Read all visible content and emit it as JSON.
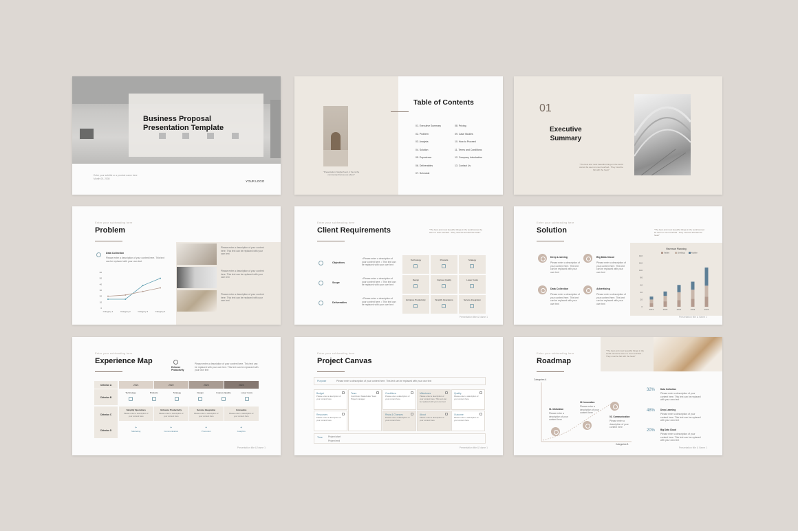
{
  "slide1": {
    "title_line1": "Business Proposal",
    "title_line2": "Presentation Template",
    "subtitle": "Enter your subtitle or a product name here",
    "date": "Month 00, 2030",
    "logo": "YOUR LOGO"
  },
  "slide2": {
    "title": "Table of Contents",
    "caption": "\"Presentation Neigborhood, tr the is the community that we are about\"",
    "items_left": [
      "01. Executive Summary",
      "02. Problem",
      "03. Analysis",
      "04. Solution",
      "05. Experience",
      "06. Deliverables",
      "07. Schedule"
    ],
    "items_right": [
      "08. Pricing",
      "09. Case Studies",
      "10. How to Proceed",
      "11. Terms and Conditions",
      "12. Company Introduction",
      "13. Contact Us"
    ]
  },
  "slide3": {
    "number": "01",
    "title_line1": "Executive",
    "title_line2": "Summary",
    "quote": "\"The best and most beautiful things in the world cannot be seen or even touched - They must be felt with the heart\""
  },
  "slide4": {
    "eyebrow": "Enter your subheading here",
    "title": "Problem",
    "section_title": "Data Collection",
    "section_text": "Please enter a description of your content here. This text can be replaced with your own text",
    "photo_texts": [
      "Please enter a description of your content here. This text can be replaced with your own text",
      "Please enter a description of your content here. This text can be replaced with your own text",
      "Please enter a description of your content here. This text can be replaced with your own text"
    ]
  },
  "slide5": {
    "eyebrow": "Enter your subheading here",
    "title": "Client Requirements",
    "quote": "\"The best and most beautiful things in the world cannot be seen or even touched - They must be felt with the heart\"",
    "rows": [
      {
        "label": "Objectives",
        "text": "• Please enter a description of your content here. • This text can be replaced with your own text"
      },
      {
        "label": "Scope",
        "text": "• Please enter a description of your content here. • This text can be replaced with your own text"
      },
      {
        "label": "Deliverables",
        "text": "• Please enter a description of your content here. • This text can be replaced with your own text"
      }
    ],
    "grid": [
      "Technology",
      "Products",
      "Strategy",
      "Design",
      "Improve Quality",
      "Lower Costs",
      "Enhance Productivity",
      "Simplify Operations",
      "Service Integration"
    ],
    "footer": "Presentation title & Name  1"
  },
  "slide6": {
    "eyebrow": "Enter your subheading here",
    "title": "Solution",
    "quote": "\"The best and most beautiful things in the world cannot be seen or even touched - They must be felt with the heart\"",
    "items": [
      {
        "title": "Deep Learning",
        "text": "Please enter a description of your content here. This text can be replaced with your own text"
      },
      {
        "title": "Big Data Cloud",
        "text": "Please enter a description of your content here. This text can be replaced with your own text"
      },
      {
        "title": "Data Collection",
        "text": "Please enter a description of your content here. This text can be replaced with your own text"
      },
      {
        "title": "Advertising",
        "text": "Please enter a description of your content here. This text can be replaced with your own text"
      }
    ],
    "footer": "Presentation title & Name  1"
  },
  "slide7": {
    "eyebrow": "Enter your subheading here",
    "title": "Experience Map",
    "badge": "Enhance Productivity",
    "desc": "Please enter a description of your content here. This text can be replaced with your own text. This text can be replaced with your own text",
    "years": [
      "2021",
      "2022",
      "2023",
      "2024"
    ],
    "criteria": [
      "Criterion A",
      "Criterion B",
      "Criterion C",
      "Criterion D"
    ],
    "rowB": [
      "Technology",
      "Products",
      "Strategy",
      "Design",
      "Improve Quality",
      "Lower Costs"
    ],
    "rowC": [
      "Simplify Operations",
      "Enhance Productivity",
      "Service Integration",
      "Innovation"
    ],
    "rowD": [
      "Marketing",
      "Communication",
      "Promotion",
      "Analytics"
    ],
    "cell_text": "Please enter a description of your content here",
    "footer": "Presentation title & Name  1"
  },
  "slide8": {
    "eyebrow": "Enter your subheading here",
    "title": "Project Canvas",
    "purpose_label": "Purpose",
    "purpose_text": "Please enter a description of your content here. This text can be replaced with your own text",
    "boxes": [
      {
        "label": "Budget",
        "text": "Please enter a description of your content here"
      },
      {
        "label": "Team",
        "text": "Contributor Stakeholder Team Project manager"
      },
      {
        "label": "Conditions",
        "text": "Please enter a description of your content here"
      },
      {
        "label": "Milestones",
        "text": "Please enter a description of your content here. This text can be replaced with your own text"
      },
      {
        "label": "Quality",
        "text": "Please enter a description of your content here"
      },
      {
        "label": "Resources",
        "text": "Please enter a description of your content here"
      },
      {
        "label": "Risks & Chances",
        "text": "Please enter a description of your content here"
      },
      {
        "label": "About",
        "text": "Please enter a description of your content here"
      },
      {
        "label": "Outcome",
        "text": "Please enter a description of your content here"
      }
    ],
    "time_label": "Time",
    "time_text1": "Project start",
    "time_text2": "Project end",
    "footer": "Presentation title & Name  1"
  },
  "slide9": {
    "eyebrow": "Enter your subheading here",
    "title": "Roadmap",
    "quote": "\"The best and most beautiful things in the world cannot be seen or even touched - They must be felt with the heart\"",
    "axis_y": "Categories A",
    "axis_x": "Categories B",
    "steps": [
      {
        "label": "01. Motivation",
        "text": "Please enter a description of your content here"
      },
      {
        "label": "02. Innovation",
        "text": "Please enter a description of your content here"
      },
      {
        "label": "03. Communication",
        "text": "Please enter a description of your content here"
      }
    ],
    "stats": [
      {
        "pct": "32%",
        "title": "Data Collection",
        "text": "Please enter a description of your content here. This text can be replaced with your own text"
      },
      {
        "pct": "48%",
        "title": "Deep Learning",
        "text": "Please enter a description of your content here. This text can be replaced with your own text"
      },
      {
        "pct": "20%",
        "title": "Big Data Cloud",
        "text": "Please enter a description of your content here. This text can be replaced with your own text"
      }
    ],
    "footer": "Presentation title & Name  1"
  },
  "chart_data": [
    {
      "type": "line",
      "categories": [
        "Category 1",
        "Category 2",
        "Category 3",
        "Category 4"
      ],
      "series": [
        {
          "values": [
            15,
            15,
            38,
            50
          ]
        },
        {
          "values": [
            20,
            22,
            28,
            34
          ]
        }
      ],
      "ylim": [
        0,
        60
      ],
      "yticks": [
        "0",
        "10",
        "20",
        "30",
        "40",
        "50",
        "60"
      ],
      "colors": [
        "#5b9db0",
        "#b49b8f"
      ]
    },
    {
      "type": "bar",
      "title": "Revenue Planning",
      "legend": [
        "Tablet",
        "Desktop",
        "Mobile"
      ],
      "categories": [
        "2019",
        "2020",
        "2021",
        "2022",
        "2023"
      ],
      "series": [
        {
          "name": "Tablet",
          "values": [
            10,
            15,
            18,
            22,
            28
          ]
        },
        {
          "name": "Desktop",
          "values": [
            10,
            15,
            22,
            25,
            30
          ]
        },
        {
          "name": "Mobile",
          "values": [
            8,
            12,
            20,
            22,
            50
          ]
        }
      ],
      "ylim": [
        0,
        140
      ],
      "yticks": [
        "0",
        "20",
        "40",
        "60",
        "80",
        "100",
        "120",
        "140"
      ],
      "colors": [
        "#b49b8f",
        "#c9b7ab",
        "#5e7f96"
      ]
    }
  ]
}
